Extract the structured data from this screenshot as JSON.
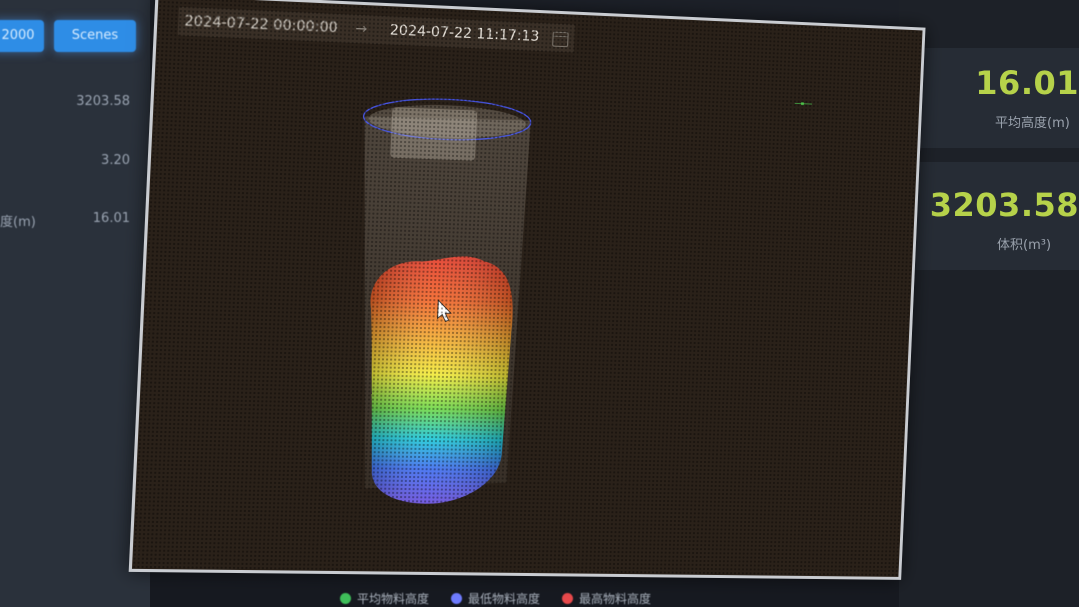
{
  "left_panel": {
    "buttons": [
      "2000",
      "Scenes"
    ],
    "rows": [
      {
        "label": "",
        "value": "3203.58"
      },
      {
        "label": "",
        "value": "3.20"
      },
      {
        "label": "度(m)",
        "value": "16.01"
      }
    ]
  },
  "modal": {
    "date_start": "2024-07-22 00:00:00",
    "date_separator": "→",
    "date_end": "2024-07-22 11:17:13"
  },
  "stats": [
    {
      "value": "16.01",
      "label": "平均高度(m)"
    },
    {
      "value": "3203.58",
      "label": "体积(m³)"
    }
  ],
  "legend": [
    {
      "label": "平均物料高度",
      "color": "#3fbf5a"
    },
    {
      "label": "最低物料高度",
      "color": "#6f7cff"
    },
    {
      "label": "最高物料高度",
      "color": "#e8494b"
    }
  ],
  "colors": {
    "accent_blue": "#2e8de6",
    "stat_green": "#b6d24a",
    "modal_border": "#c9ccd1"
  }
}
